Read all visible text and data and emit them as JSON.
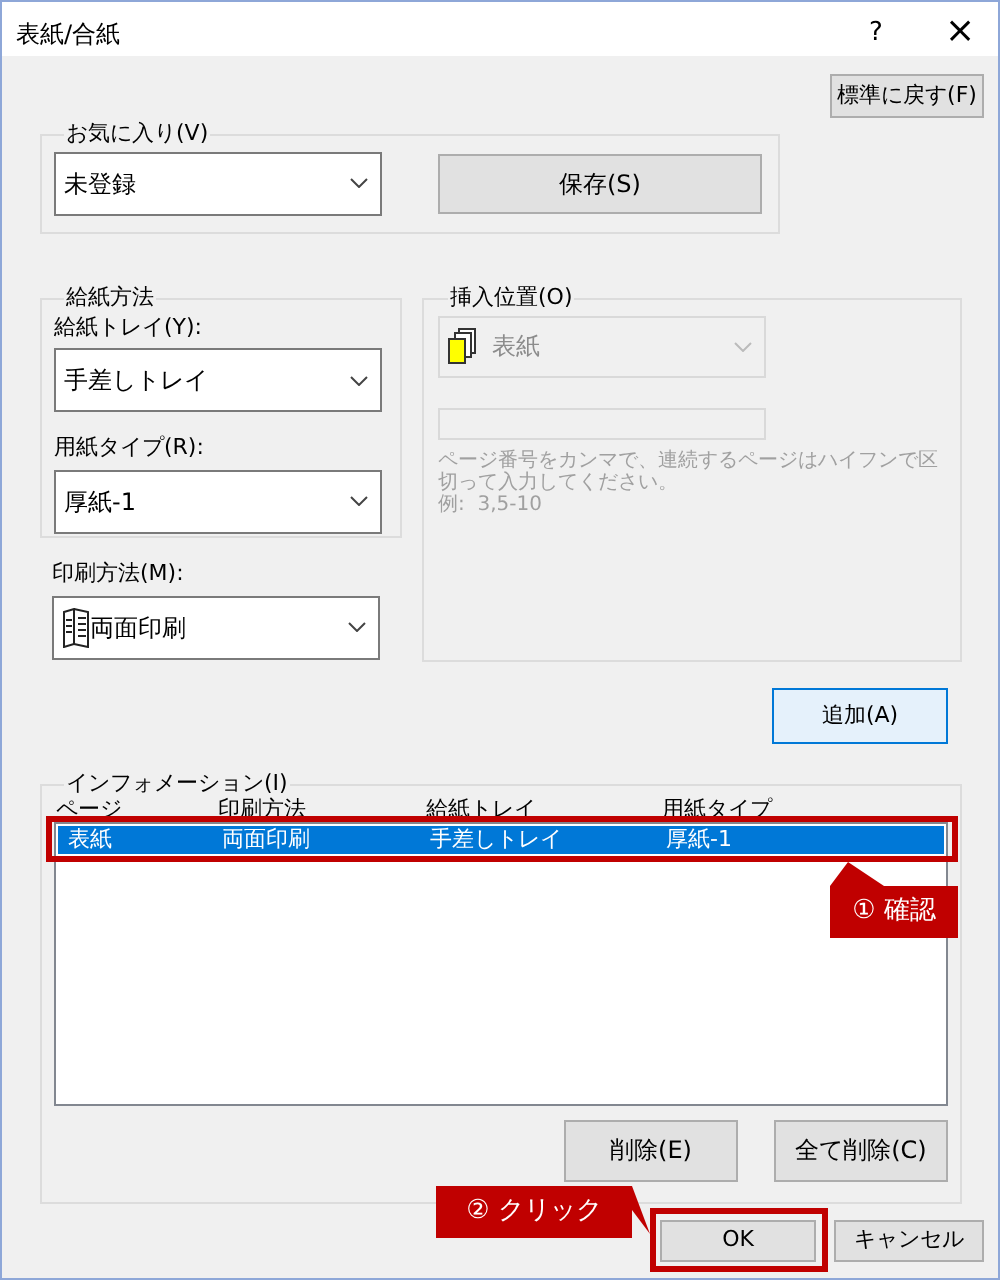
{
  "window": {
    "title": "表紙/合紙",
    "help": "?",
    "close": "×"
  },
  "reset_button": "標準に戻す(F)",
  "favorites": {
    "label": "お気に入り(V)",
    "value": "未登録",
    "save_button": "保存(S)"
  },
  "paper_feed": {
    "label": "給紙方法",
    "tray_label": "給紙トレイ(Y):",
    "tray_value": "手差しトレイ",
    "type_label": "用紙タイプ(R):",
    "type_value": "厚紙-1"
  },
  "print_method": {
    "label": "印刷方法(M):",
    "value": "両面印刷"
  },
  "insert_position": {
    "label": "挿入位置(O)",
    "value": "表紙",
    "disabled": true,
    "hint": "ページ番号をカンマで、連続するページはハイフンで区切って入力してください。",
    "example": "例:  3,5-10"
  },
  "add_button": "追加(A)",
  "information": {
    "label": "インフォメーション(I)",
    "columns": [
      "ページ",
      "印刷方法",
      "給紙トレイ",
      "用紙タイプ"
    ],
    "rows": [
      {
        "cells": [
          "表紙",
          "両面印刷",
          "手差しトレイ",
          "厚紙-1"
        ],
        "selected": true
      }
    ]
  },
  "delete_button": "削除(E)",
  "delete_all_button": "全て削除(C)",
  "ok_button": "OK",
  "cancel_button": "キャンセル",
  "callouts": [
    {
      "number": "①",
      "text": "確認"
    },
    {
      "number": "②",
      "text": "クリック"
    }
  ]
}
